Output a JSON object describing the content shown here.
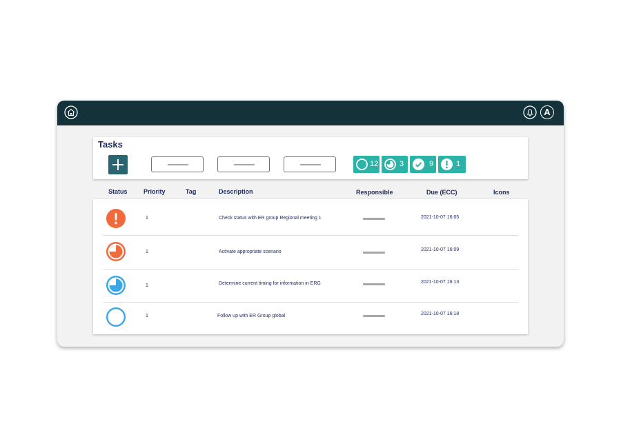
{
  "topbar": {
    "avatar_letter": "A"
  },
  "tasks": {
    "title": "Tasks",
    "counters": [
      {
        "icon": "open-circle-icon",
        "count": "12"
      },
      {
        "icon": "in-progress-icon",
        "count": "3"
      },
      {
        "icon": "check-circle-icon",
        "count": "9"
      },
      {
        "icon": "alert-circle-icon",
        "count": "1"
      }
    ]
  },
  "table": {
    "columns": [
      "Status",
      "Priority",
      "Tag",
      "Description",
      "Responsible",
      "Due (ECC)",
      "Icons"
    ],
    "rows": [
      {
        "status": "alert-status-icon",
        "priority": "1",
        "description": "Check status with ER group Regional meeting 1",
        "due": "2021-10-07 16:05"
      },
      {
        "status": "progress-orange-status-icon",
        "priority": "1",
        "description": "Activate appropriate scenario",
        "due": "2021-10-07 16:09"
      },
      {
        "status": "progress-blue-status-icon",
        "priority": "1",
        "description": "Determine current timing for information in ERG",
        "due": "2021-10-07 16:13"
      },
      {
        "status": "open-status-icon",
        "priority": "1",
        "description": "Follow up with ER Group global",
        "due": "2021-10-07 16:18"
      }
    ]
  },
  "colors": {
    "topbar": "#14323a",
    "counter": "#2bb3a8",
    "alert": "#f06a3c",
    "blue": "#3aa6e8",
    "add_button": "#2a6470"
  }
}
